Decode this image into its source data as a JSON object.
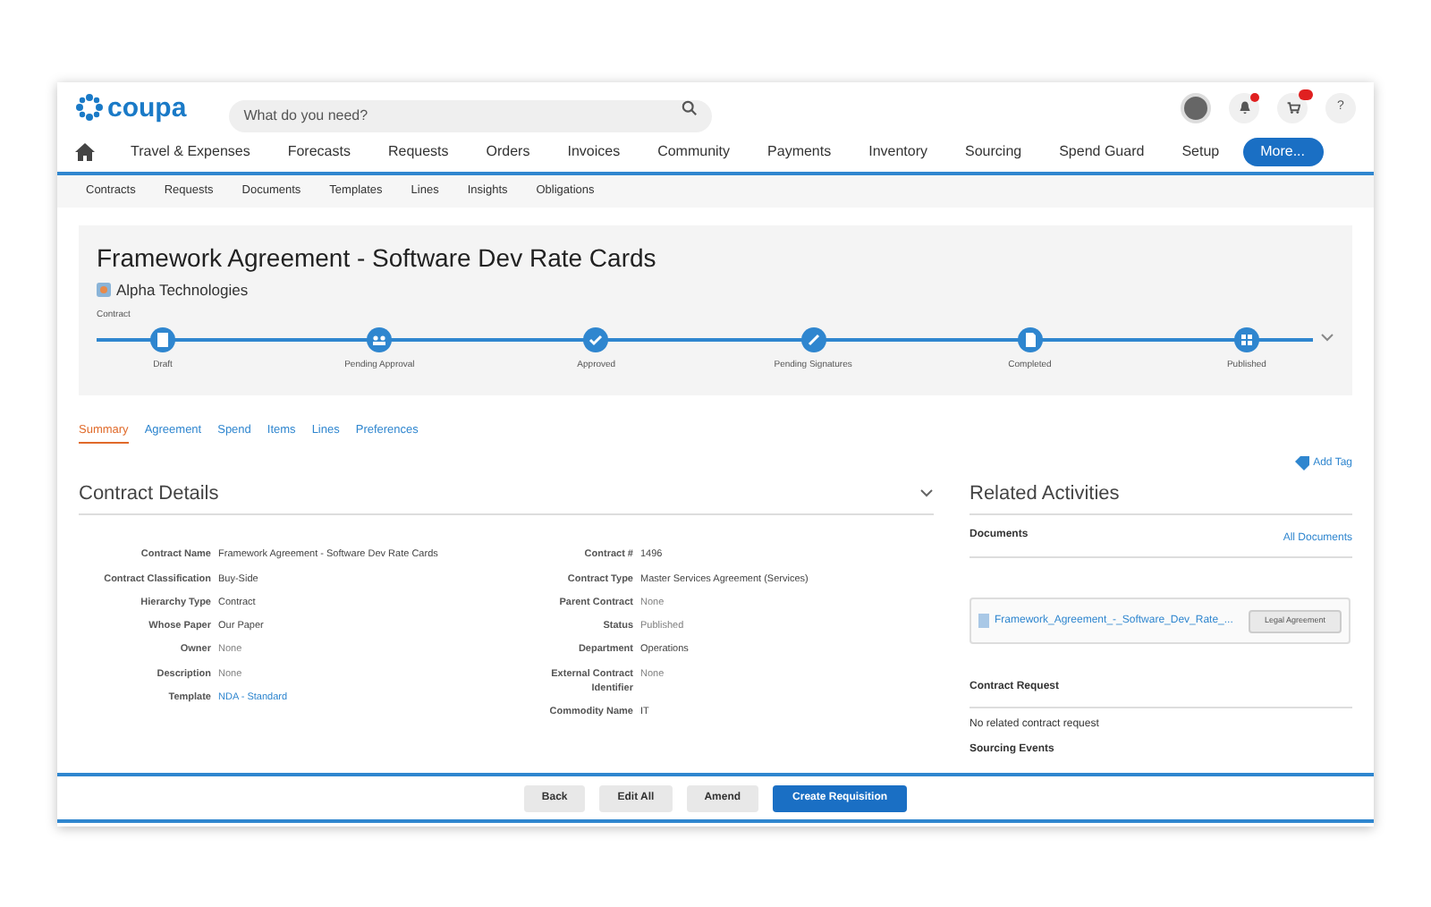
{
  "header": {
    "logo": "coupa",
    "search": {
      "placeholder": "What do you need?"
    },
    "help": "?"
  },
  "nav": [
    {
      "label": "Travel & Expenses",
      "kind": "link"
    },
    {
      "label": "Forecasts",
      "kind": "link"
    },
    {
      "label": "Requests",
      "kind": "link"
    },
    {
      "label": "Orders",
      "kind": "link"
    },
    {
      "label": "Invoices",
      "kind": "link"
    },
    {
      "label": "Community",
      "kind": "link"
    },
    {
      "label": "Payments",
      "kind": "link"
    },
    {
      "label": "Inventory",
      "kind": "link"
    },
    {
      "label": "Sourcing",
      "kind": "link"
    },
    {
      "label": "Spend Guard",
      "kind": "link"
    },
    {
      "label": "Setup",
      "kind": "link"
    },
    {
      "label": "More...",
      "kind": "pill"
    }
  ],
  "subnav": [
    "Contracts",
    "Requests",
    "Documents",
    "Templates",
    "Lines",
    "Insights",
    "Obligations"
  ],
  "contract": {
    "title": "Framework Agreement - Software Dev Rate Cards",
    "supplier": "Alpha Technologies",
    "label": "Contract",
    "steps": [
      "Draft",
      "Pending Approval",
      "Approved",
      "Pending Signatures",
      "Completed",
      "Published"
    ]
  },
  "tabs": [
    {
      "label": "Summary",
      "selected": true
    },
    {
      "label": "Agreement",
      "selected": false
    },
    {
      "label": "Spend",
      "selected": false
    },
    {
      "label": "Items",
      "selected": false
    },
    {
      "label": "Lines",
      "selected": false
    },
    {
      "label": "Preferences",
      "selected": false
    }
  ],
  "add_tag": "Add Tag",
  "details": {
    "title": "Contract Details",
    "left": [
      {
        "label": "Contract Name",
        "value": "Framework Agreement - Software Dev Rate Cards",
        "kind": "text"
      },
      {
        "label": "Contract Classification",
        "value": "Buy-Side",
        "kind": "text"
      },
      {
        "label": "Hierarchy Type",
        "value": "Contract",
        "kind": "text"
      },
      {
        "label": "Whose Paper",
        "value": "Our Paper",
        "kind": "text"
      },
      {
        "label": "Owner",
        "value": "None",
        "kind": "muted"
      },
      {
        "label": "Description",
        "value": "None",
        "kind": "muted"
      },
      {
        "label": "Template",
        "value": "NDA - Standard",
        "kind": "link"
      }
    ],
    "right": [
      {
        "label": "Contract #",
        "value": "1496",
        "kind": "text"
      },
      {
        "label": "Contract Type",
        "value": "Master Services Agreement (Services)",
        "kind": "text"
      },
      {
        "label": "Parent Contract",
        "value": "None",
        "kind": "muted"
      },
      {
        "label": "Status",
        "value": "Published",
        "kind": "muted"
      },
      {
        "label": "Department",
        "value": "Operations",
        "kind": "text"
      },
      {
        "label": "External Contract Identifier",
        "value": "None",
        "kind": "muted"
      },
      {
        "label": "Commodity Name",
        "value": "IT",
        "kind": "text"
      }
    ]
  },
  "related": {
    "title": "Related Activities",
    "documents_heading": "Documents",
    "all_documents": "All Documents",
    "document": {
      "name": "Framework_Agreement_-_Software_Dev_Rate_...",
      "type": "Legal Agreement"
    },
    "request_heading": "Contract Request",
    "request_text": "No related contract request",
    "sourcing_heading": "Sourcing Events"
  },
  "buttons": [
    {
      "label": "Back",
      "kind": "secondary"
    },
    {
      "label": "Edit All",
      "kind": "secondary"
    },
    {
      "label": "Amend",
      "kind": "secondary"
    },
    {
      "label": "Create Requisition",
      "kind": "primary"
    }
  ]
}
